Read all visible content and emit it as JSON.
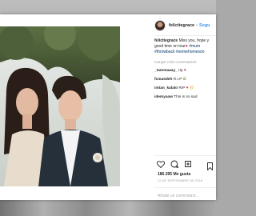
{
  "post": {
    "username": "felicitegrace",
    "follow_label": "Segu",
    "caption": {
      "text_line1": "Miss you, hope y",
      "text_line2_pre": "good time on tour",
      "tags_line2": " #mum",
      "tags_line3": "#throwback #somehomesoo"
    },
    "load_more": "Cargar más comentarios",
    "comments": [
      {
        "user": "_tammaaay_",
        "text": "rip"
      },
      {
        "user": "fcmaedeh",
        "text": "R.I.P"
      },
      {
        "user": "imtan_kalalo",
        "text": "RIP"
      },
      {
        "user": "idemyaaw",
        "text": "This is so sad"
      }
    ],
    "likes": "186.395 Me gusta",
    "date": "11 DE SEPTIEMBRE DE 2016",
    "add_comment_placeholder": "Añade un comentario..."
  },
  "icons": {
    "like": "heart-icon",
    "comment": "comment-icon",
    "share": "share-icon",
    "save": "bookmark-icon"
  },
  "colors": {
    "link_blue": "#3897f0",
    "heart_red": "#e0245e",
    "text_dark": "#262626",
    "muted": "#999999"
  }
}
